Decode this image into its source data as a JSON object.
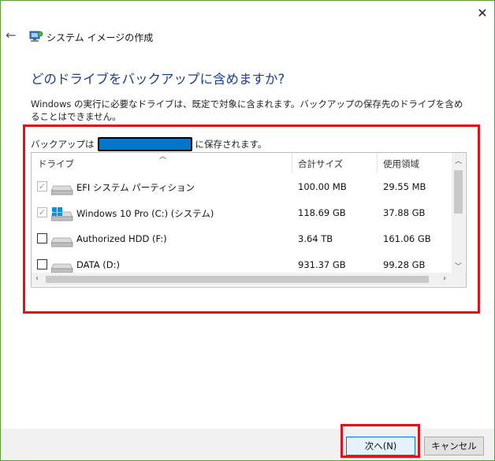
{
  "window": {
    "close_glyph": "✕"
  },
  "header": {
    "back_glyph": "←",
    "title": "システム イメージの作成",
    "icon": "system-image-icon"
  },
  "heading": "どのドライブをバックアップに含めますか?",
  "description": "Windows の実行に必要なドライブは、既定で対象に含まれます。バックアップの保存先のドライブを含めることはできません。",
  "save_location": {
    "prefix": "バックアップは",
    "suffix": "に保存されます。"
  },
  "table": {
    "columns": [
      "ドライブ",
      "合計サイズ",
      "使用領域"
    ],
    "rows": [
      {
        "name": "EFI システム パーティション",
        "size": "100.00 MB",
        "used": "29.55 MB",
        "checked": true,
        "disabled": true,
        "icon": "hard-drive-icon"
      },
      {
        "name": "Windows 10 Pro (C:) (システム)",
        "size": "118.69 GB",
        "used": "37.88 GB",
        "checked": true,
        "disabled": true,
        "icon": "windows-drive-icon"
      },
      {
        "name": "Authorized HDD (F:)",
        "size": "3.64 TB",
        "used": "161.06 GB",
        "checked": false,
        "disabled": false,
        "icon": "hard-drive-icon"
      },
      {
        "name": "DATA (D:)",
        "size": "931.37 GB",
        "used": "99.28 GB",
        "checked": false,
        "disabled": false,
        "icon": "hard-drive-icon"
      }
    ]
  },
  "buttons": {
    "next": "次へ(N)",
    "cancel": "キャンセル"
  },
  "colors": {
    "heading": "#1b3e8f",
    "highlight": "#e0131c",
    "redaction": "#0077c8"
  }
}
